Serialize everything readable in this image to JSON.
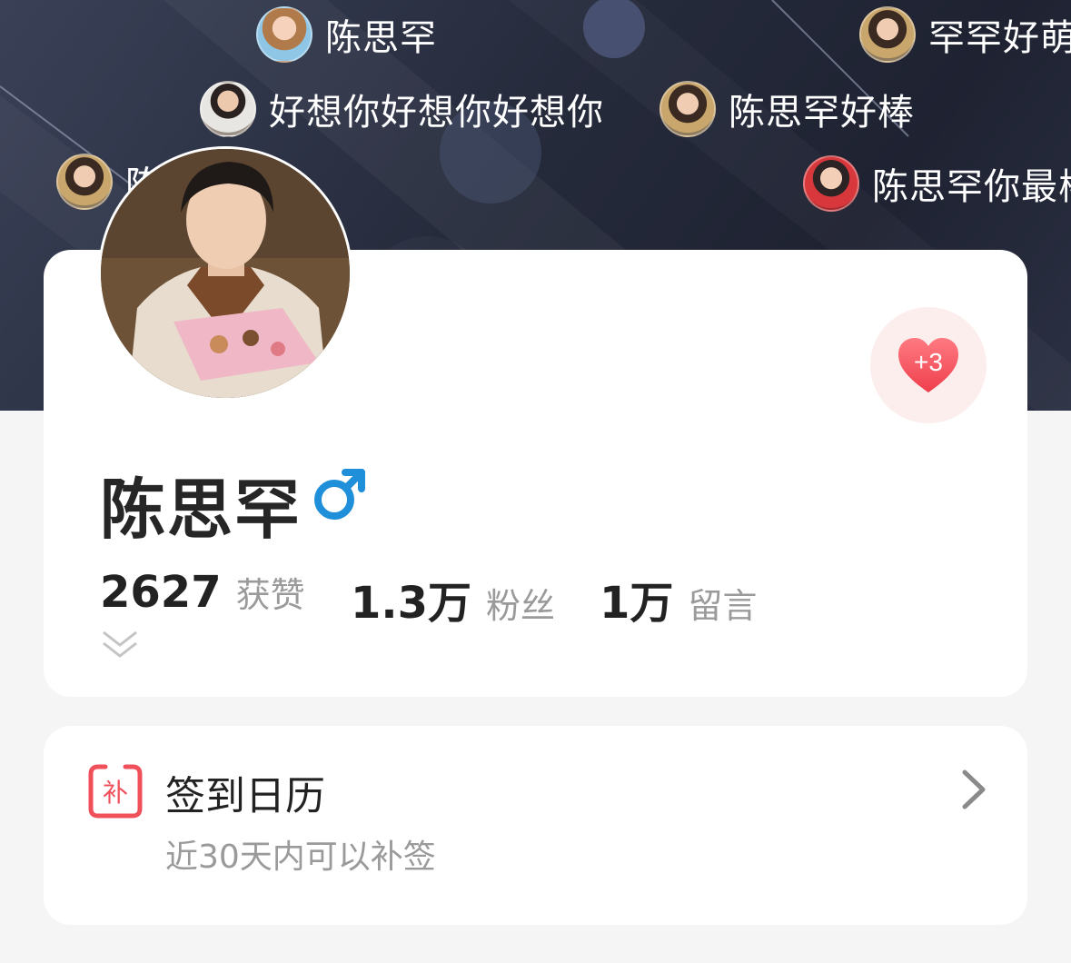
{
  "danmaku": [
    {
      "text": "陈思罕",
      "avatar": "avatar-girl-icon"
    },
    {
      "text": "罕罕好萌",
      "avatar": "avatar-boy-icon"
    },
    {
      "text": "好想你好想你好想你",
      "avatar": "avatar-boy-icon"
    },
    {
      "text": "陈思罕好棒",
      "avatar": "avatar-boy-icon"
    },
    {
      "text": "陈",
      "avatar": "avatar-boy-icon"
    },
    {
      "text": "陈思罕你最棒",
      "avatar": "avatar-boy-icon"
    }
  ],
  "profile": {
    "name": "陈思罕",
    "gender": "male",
    "gender_symbol": "♂",
    "like_badge": "+3",
    "stats": [
      {
        "value": "2627",
        "label": "获赞"
      },
      {
        "value": "1.3万",
        "label": "粉丝"
      },
      {
        "value": "1万",
        "label": "留言"
      }
    ]
  },
  "checkin": {
    "icon_char": "补",
    "title": "签到日历",
    "subtitle": "近30天内可以补签"
  },
  "colors": {
    "banner": "#262b3c",
    "accent_red": "#f0505a",
    "gender_blue": "#1f8fd9",
    "text_primary": "#222222",
    "text_secondary": "#9a9a9a"
  }
}
